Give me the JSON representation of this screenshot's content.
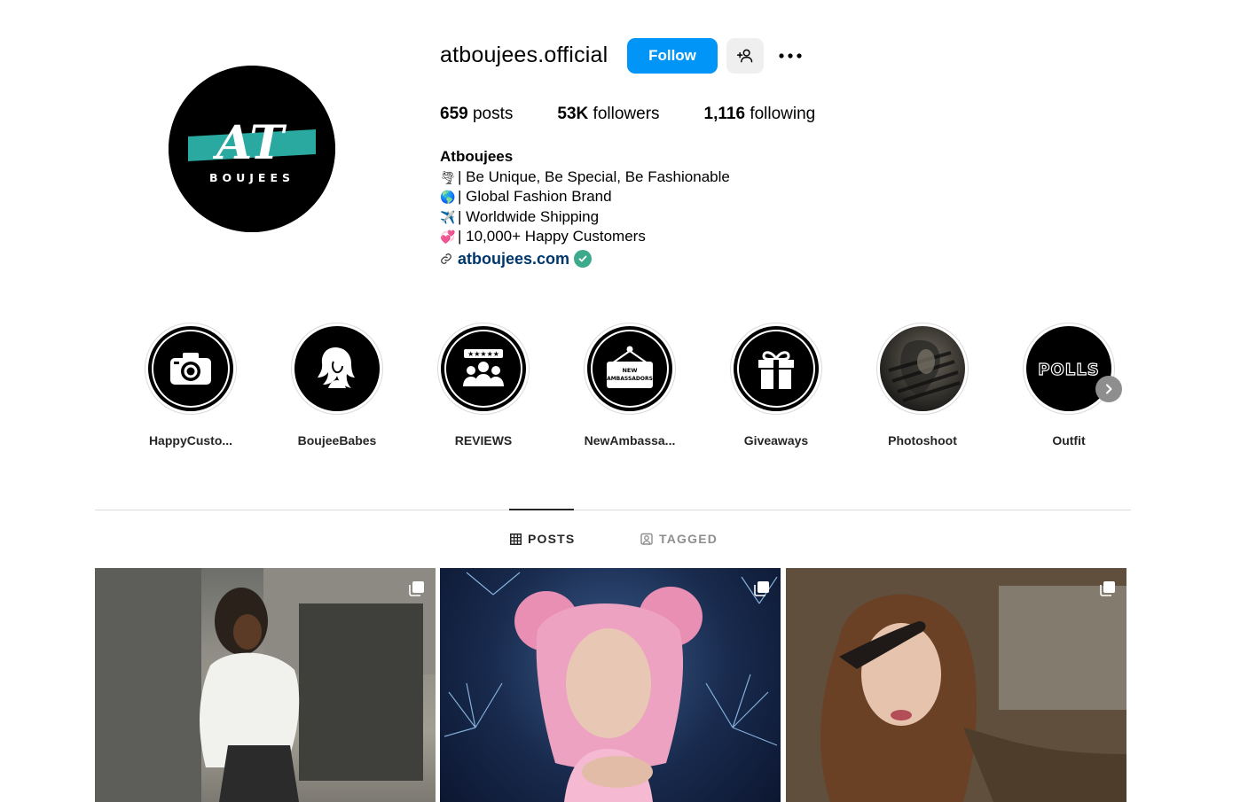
{
  "profile": {
    "username": "atboujees.official",
    "follow_label": "Follow",
    "avatar_logo_letters": "AT",
    "avatar_logo_text": "BOUJEES",
    "stats": {
      "posts_count": "659",
      "posts_label": "posts",
      "followers_count": "53K",
      "followers_label": "followers",
      "following_count": "1,116",
      "following_label": "following"
    },
    "bio": {
      "name": "Atboujees",
      "lines": [
        {
          "emoji": "🌪",
          "text": "| Be Unique, Be Special, Be Fashionable"
        },
        {
          "emoji": "🌎",
          "text": "| Global Fashion Brand"
        },
        {
          "emoji": "✈️",
          "text": "| Worldwide Shipping"
        },
        {
          "emoji": "💞",
          "text": "| 10,000+ Happy Customers"
        }
      ],
      "link": "atboujees.com"
    }
  },
  "highlights": [
    {
      "label": "HappyCusto...",
      "icon": "camera-icon"
    },
    {
      "label": "BoujeeBabes",
      "icon": "woman-silhouette-icon"
    },
    {
      "label": "REVIEWS",
      "icon": "reviews-icon"
    },
    {
      "label": "NewAmbassa...",
      "icon": "new-ambassadors-sign-icon",
      "sign_text_1": "NEW",
      "sign_text_2": "AMBASSADORS"
    },
    {
      "label": "Giveaways",
      "icon": "gift-icon"
    },
    {
      "label": "Photoshoot",
      "icon": "photo-thumbnail"
    },
    {
      "label": "Outfit",
      "icon": "polls-icon",
      "cover_text": "POLLS"
    }
  ],
  "tabs": [
    {
      "label": "POSTS",
      "icon": "grid-icon",
      "active": true
    },
    {
      "label": "TAGGED",
      "icon": "tagged-icon",
      "active": false
    }
  ],
  "posts": [
    {
      "icon": "carousel-icon"
    },
    {
      "icon": "carousel-icon"
    },
    {
      "icon": "carousel-icon"
    }
  ],
  "colors": {
    "follow_button": "#0095f6",
    "logo_teal": "#2aa9a0",
    "verified_badge": "#3eaa8c",
    "link": "#00376b"
  }
}
